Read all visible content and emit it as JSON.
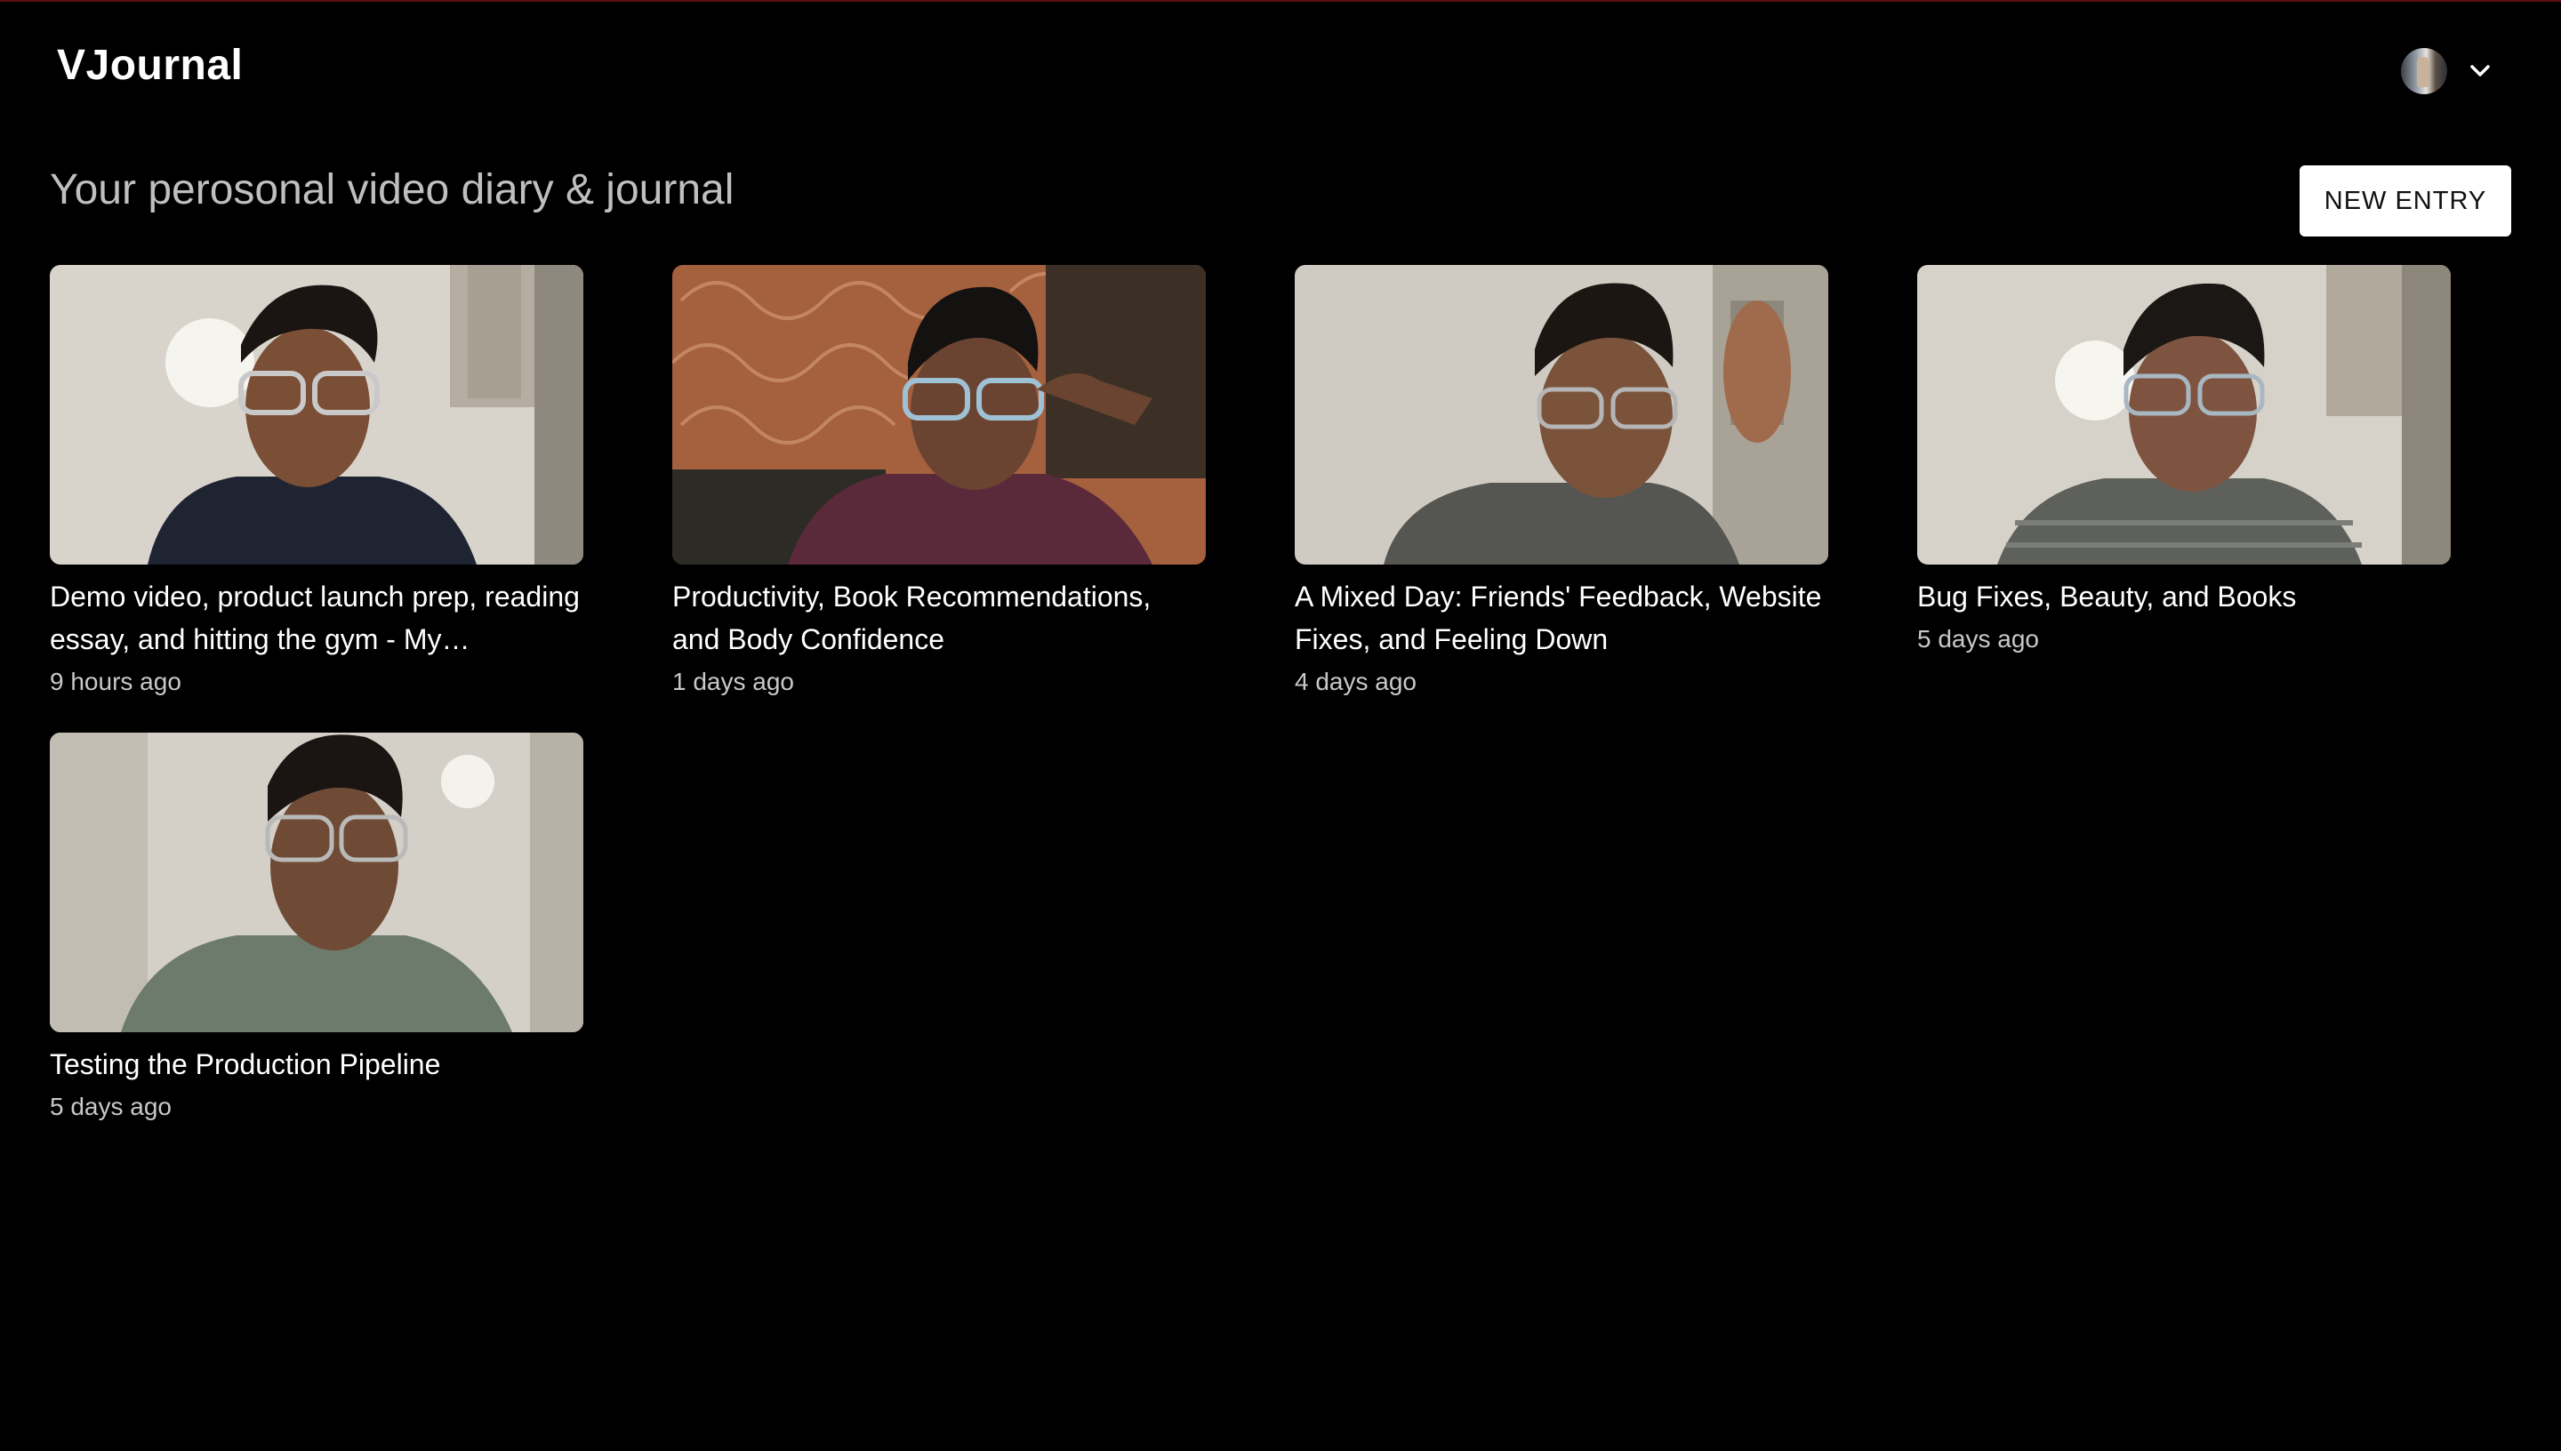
{
  "app": {
    "title": "VJournal"
  },
  "header": {
    "tagline": "Your perosonal video diary & journal",
    "new_entry_label": "NEW ENTRY"
  },
  "user_menu": {
    "avatar_icon": "avatar-photo",
    "chevron_icon": "chevron-down-icon"
  },
  "entries": [
    {
      "title": "Demo video, product launch prep, reading essay, and hitting the gym - My…",
      "time": "9 hours ago"
    },
    {
      "title": "Productivity, Book Recommendations, and Body Confidence",
      "time": "1 days ago"
    },
    {
      "title": "A Mixed Day: Friends' Feedback, Website Fixes, and Feeling Down",
      "time": "4 days ago"
    },
    {
      "title": "Bug Fixes, Beauty, and Books",
      "time": "5 days ago"
    },
    {
      "title": "Testing the Production Pipeline",
      "time": "5 days ago"
    }
  ],
  "colors": {
    "background": "#000000",
    "text": "#ffffff",
    "muted": "#bfbfbf",
    "button_bg": "#ffffff",
    "button_text": "#111111"
  }
}
